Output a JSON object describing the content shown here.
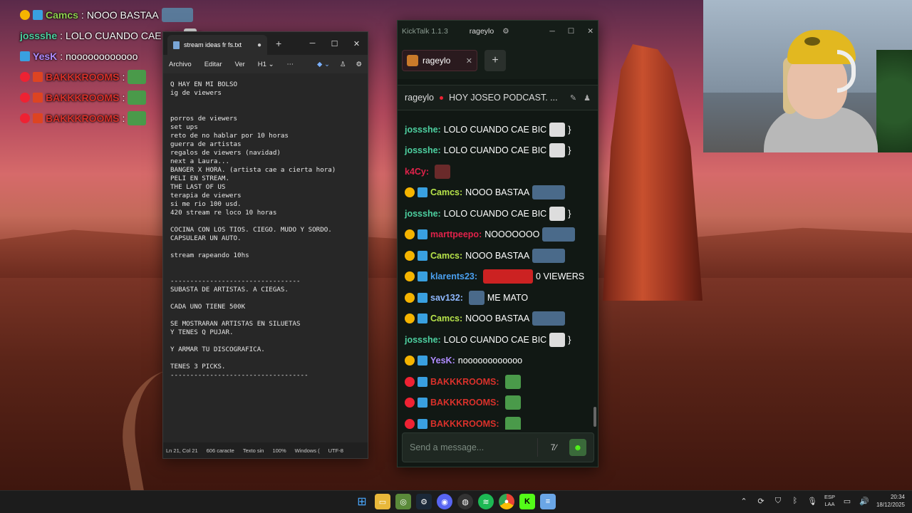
{
  "overlay": {
    "messages": [
      {
        "user": "Camcs",
        "text": "NOOO BASTAA",
        "color": "#8fd14f"
      },
      {
        "user": "jossshe",
        "text": "LOLO CUANDO CAE BIC",
        "extra": "}",
        "color": "#4dd0a0"
      },
      {
        "user": "YesK",
        "text": "noooooooooooo",
        "color": "#b08cff"
      },
      {
        "user": "BAKKKROOMS",
        "text": "",
        "color": "#d9312b"
      },
      {
        "user": "BAKKKROOMS",
        "text": "",
        "color": "#d9312b"
      },
      {
        "user": "BAKKKROOMS",
        "text": "",
        "color": "#d9312b"
      }
    ]
  },
  "notepad": {
    "tab_title": "stream ideas fr fs.txt",
    "menu": [
      "Archivo",
      "Editar",
      "Ver"
    ],
    "heading_menu": "H1",
    "lines": [
      "Q HAY EN MI BOLSO",
      "ig de viewers",
      "",
      "",
      "porros de viewers",
      "set ups",
      "reto de no hablar por 10 horas",
      "guerra de artistas",
      "regalos de viewers (navidad)",
      "next a Laura...",
      "BANGER X HORA. (artista cae a cierta hora)",
      "PELI EN STREAM.",
      "THE LAST OF US",
      "terapia de viewers",
      "si me rio 100 usd.",
      "420 stream re loco 10 horas",
      "",
      "COCINA CON LOS TIOS. CIEGO. MUDO Y SORDO.",
      "CAPSULEAR UN AUTO.",
      "",
      "stream rapeando 10hs",
      "",
      "",
      "---------------------------------",
      "SUBASTA DE ARTISTAS. A CIEGAS.",
      "",
      "CADA UNO TIENE 500K",
      "",
      "SE MOSTRARAN ARTISTAS EN SILUETAS",
      "Y TENES Q PUJAR.",
      "",
      "Y ARMAR TU DISCOGRAFICA.",
      "",
      "TENES 3 PICKS.",
      "-----------------------------------"
    ],
    "status": {
      "position": "Ln 21, Col 21",
      "chars": "606 caracte",
      "format": "Texto sin",
      "zoom": "100%",
      "eol": "Windows (",
      "encoding": "UTF-8"
    }
  },
  "kicktalk": {
    "app_title": "KickTalk 1.1.3",
    "user": "rageylo",
    "tab_label": "rageylo",
    "channel_name": "rageylo",
    "stream_title": "HOY JOSEO PODCAST. ...",
    "input_placeholder": "Send a message...",
    "messages": [
      {
        "user": "jossshe:",
        "text": "LOLO CUANDO CAE BIC",
        "extra": "}",
        "color": "#4dd0a0",
        "emote": true
      },
      {
        "user": "jossshe:",
        "text": "LOLO CUANDO CAE BIC",
        "extra": "}",
        "color": "#4dd0a0",
        "emote": true
      },
      {
        "user": "k4Cy:",
        "text": "",
        "extra": "",
        "color": "#e0224a",
        "emote": true
      },
      {
        "user": "Camcs:",
        "text": "NOOO BASTAA",
        "extra": "",
        "color": "#b7e34a",
        "emote": true,
        "badges": true
      },
      {
        "user": "jossshe:",
        "text": "LOLO CUANDO CAE BIC",
        "extra": "}",
        "color": "#4dd0a0",
        "emote": true
      },
      {
        "user": "marttpeepo:",
        "text": "NOOOOOOO",
        "extra": "",
        "color": "#e0224a",
        "emote": true,
        "badges": true
      },
      {
        "user": "Camcs:",
        "text": "NOOO BASTAA",
        "extra": "",
        "color": "#b7e34a",
        "emote": true,
        "badges": true
      },
      {
        "user": "klarents23:",
        "text": "",
        "extra": "0 VIEWERS",
        "color": "#4aa0f0",
        "emote": true,
        "badges": true
      },
      {
        "user": "sav132:",
        "text": "",
        "extra": "ME MATO",
        "color": "#8fb8ff",
        "emote": true,
        "badges": true
      },
      {
        "user": "Camcs:",
        "text": "NOOO BASTAA",
        "extra": "",
        "color": "#b7e34a",
        "emote": true,
        "badges": true
      },
      {
        "user": "jossshe:",
        "text": "LOLO CUANDO CAE BIC",
        "extra": "}",
        "color": "#4dd0a0",
        "emote": true
      },
      {
        "user": "YesK:",
        "text": "noooooooooooo",
        "extra": "",
        "color": "#b08cff",
        "emote": false,
        "badges": true
      },
      {
        "user": "BAKKKROOMS:",
        "text": "",
        "extra": "",
        "color": "#d9312b",
        "emote": true,
        "badges": true
      },
      {
        "user": "BAKKKROOMS:",
        "text": "",
        "extra": "",
        "color": "#d9312b",
        "emote": true,
        "badges": true
      },
      {
        "user": "BAKKKROOMS:",
        "text": "",
        "extra": "",
        "color": "#d9312b",
        "emote": true,
        "badges": true
      }
    ]
  },
  "taskbar": {
    "icons": [
      "windows-start",
      "file-explorer",
      "xbox",
      "steam",
      "discord",
      "obs",
      "spotify",
      "chrome",
      "kick",
      "notepad"
    ],
    "lang_line1": "ESP",
    "lang_line2": "LAA",
    "time": "20:34",
    "date": "18/12/2025"
  },
  "colors": {
    "kick_green": "#53fc18",
    "notepad_bg": "#272727",
    "kicktalk_bg": "#111814"
  }
}
